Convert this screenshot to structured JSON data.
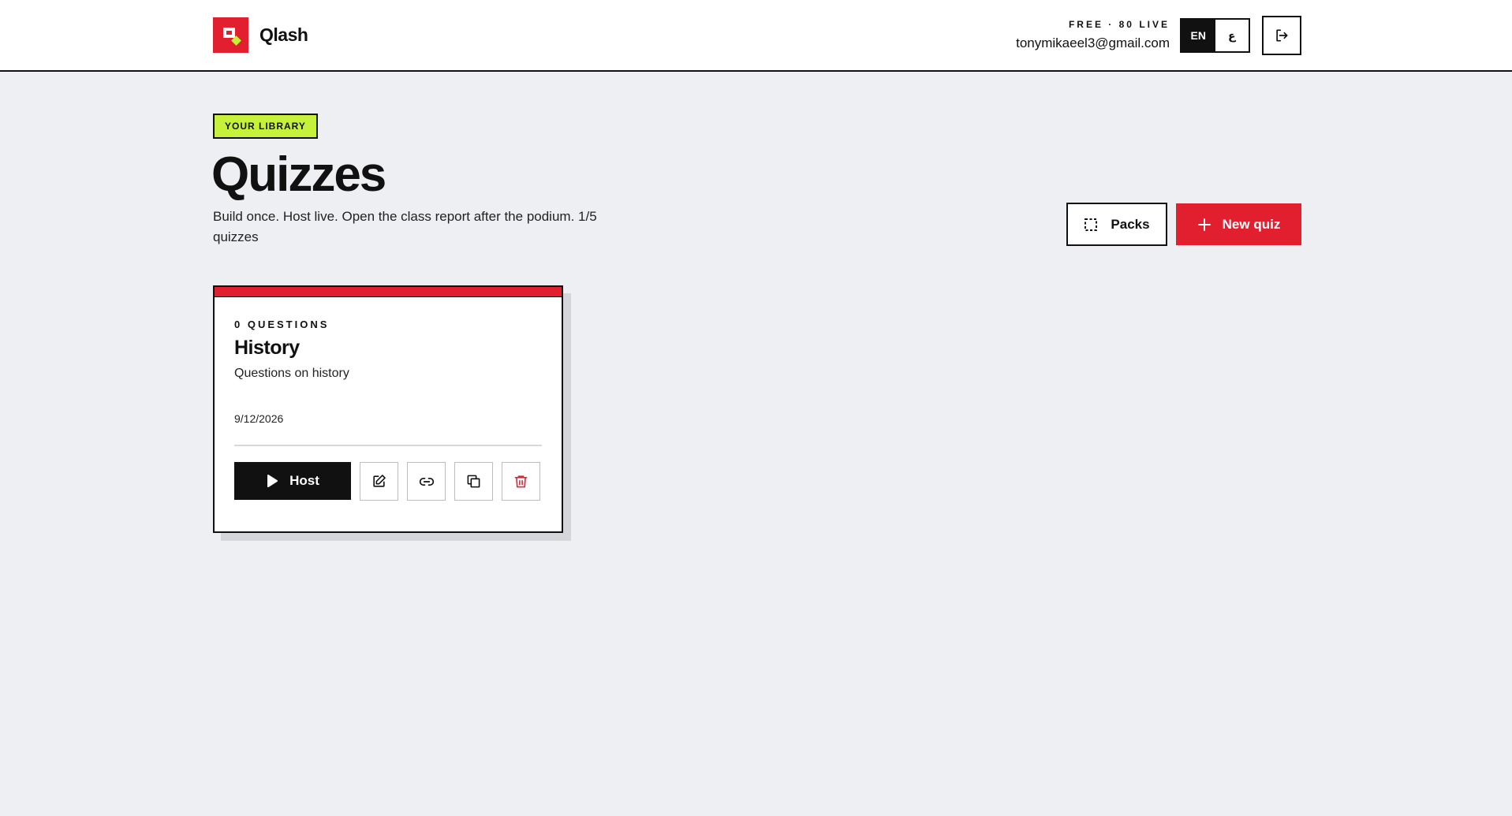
{
  "header": {
    "brand": "Qlash",
    "plan_status": "FREE · 80 LIVE",
    "email": "tonymikaeel3@gmail.com",
    "languages": [
      {
        "label": "EN",
        "active": true
      },
      {
        "label": "ع",
        "active": false
      }
    ],
    "logout_icon": "logout-icon"
  },
  "hero": {
    "badge": "YOUR LIBRARY",
    "title": "Quizzes",
    "subtitle": "Build once. Host live. Open the class report after the podium. 1/5 quizzes",
    "packs_button": "Packs",
    "new_quiz_button": "New quiz"
  },
  "quizzes": [
    {
      "question_count": "0 QUESTIONS",
      "title": "History",
      "description": "Questions on history",
      "date": "9/12/2026",
      "host_label": "Host",
      "accent_color": "#e21f2f"
    }
  ],
  "colors": {
    "accent_red": "#e21f2f",
    "accent_lime": "#c5f13a",
    "ink": "#111111",
    "background": "#edeff2"
  }
}
